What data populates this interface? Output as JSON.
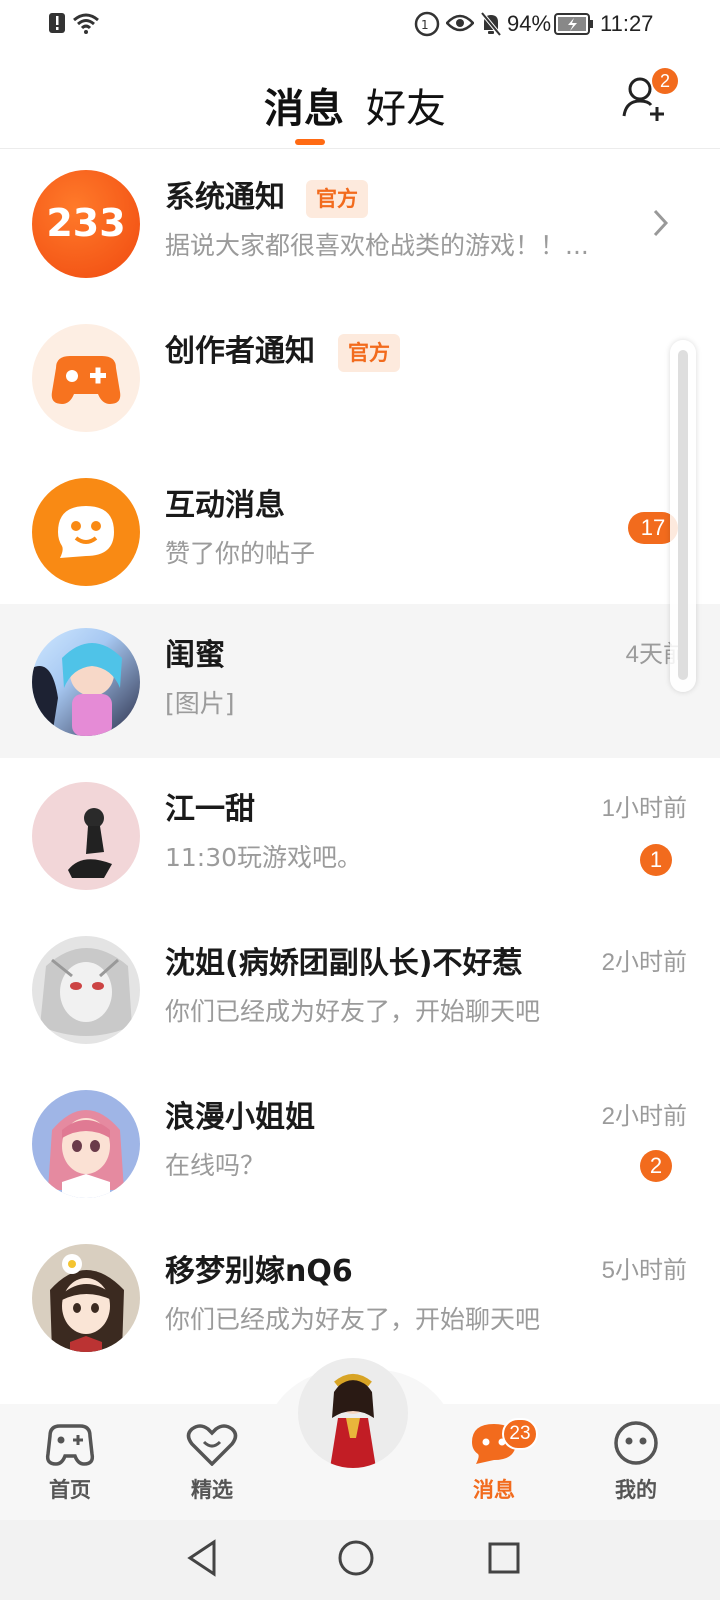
{
  "status_bar": {
    "battery": "94%",
    "time": "11:27"
  },
  "header": {
    "tab_messages": "消息",
    "tab_friends": "好友",
    "add_friend_badge": "2"
  },
  "messages": [
    {
      "name": "系统通知",
      "tag": "官方",
      "preview": "据说大家都很喜欢枪战类的游戏！！...",
      "time": "",
      "badge": "",
      "avatar_icon": "233-logo-icon",
      "avatar_text": "233"
    },
    {
      "name": "创作者通知",
      "tag": "官方",
      "preview": "",
      "time": "",
      "badge": "",
      "avatar_icon": "gamepad-icon"
    },
    {
      "name": "互动消息",
      "tag": "",
      "preview": "赞了你的帖子",
      "time": "",
      "badge": "17",
      "avatar_icon": "chat-smile-icon"
    },
    {
      "name": "闺蜜",
      "tag": "",
      "preview": "[图片]",
      "time": "4天前",
      "badge": "",
      "avatar_icon": "anime-avatar"
    },
    {
      "name": "江一甜",
      "tag": "",
      "preview": "11:30玩游戏吧。",
      "time": "1小时前",
      "badge": "1",
      "avatar_icon": "anime-avatar"
    },
    {
      "name": "沈姐(病娇团副队长)不好惹",
      "tag": "",
      "preview": "你们已经成为好友了，开始聊天吧",
      "time": "2小时前",
      "badge": "",
      "avatar_icon": "anime-avatar"
    },
    {
      "name": "浪漫小姐姐",
      "tag": "",
      "preview": "在线吗？",
      "time": "2小时前",
      "badge": "2",
      "avatar_icon": "anime-avatar"
    },
    {
      "name": "移梦别嫁nQ6",
      "tag": "",
      "preview": "你们已经成为好友了，开始聊天吧",
      "time": "5小时前",
      "badge": "",
      "avatar_icon": "anime-avatar"
    }
  ],
  "bottom_nav": {
    "items": [
      {
        "label": "首页",
        "icon": "gamepad-icon"
      },
      {
        "label": "精选",
        "icon": "heart-icon"
      },
      {
        "label": "",
        "icon": "character-avatar"
      },
      {
        "label": "消息",
        "icon": "chat-icon",
        "badge": "23",
        "active": true
      },
      {
        "label": "我的",
        "icon": "smile-face-icon"
      }
    ]
  },
  "colors": {
    "accent": "#f26b1d",
    "tag_bg": "#fdeadd",
    "highlight_row": "#f5f5f5"
  }
}
